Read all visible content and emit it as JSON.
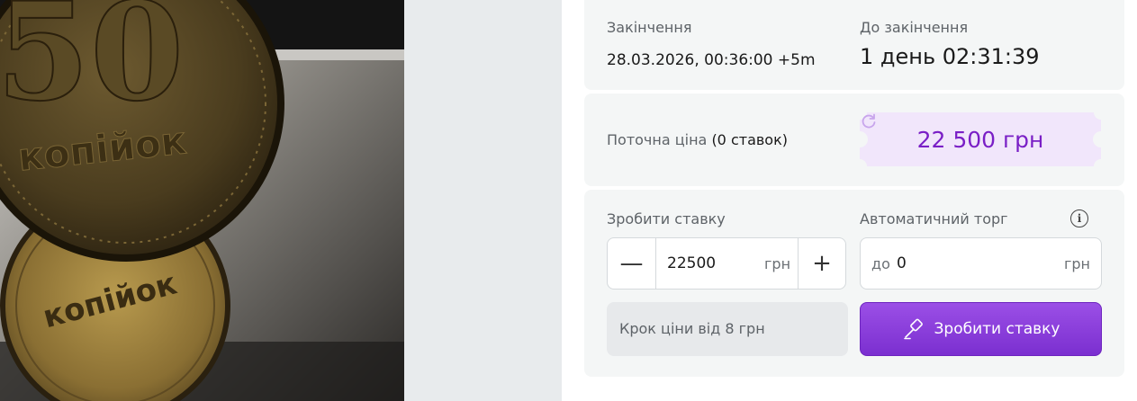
{
  "ending": {
    "label": "Закінчення",
    "datetime": "28.03.2026, 00:36:00 +5m"
  },
  "countdown": {
    "label": "До закінчення",
    "value": "1 день 02:31:39"
  },
  "price": {
    "label": "Поточна ціна",
    "bids": "(0 ставок)",
    "value": "22 500 грн"
  },
  "bid": {
    "label": "Зробити ставку",
    "amount": "22500",
    "unit": "грн",
    "minus": "—",
    "plus": "+"
  },
  "auto": {
    "label": "Автоматичний торг",
    "prefix": "до",
    "amount": "0",
    "unit": "грн",
    "info": "i"
  },
  "step": {
    "text": "Крок ціни від 8 грн"
  },
  "submit": {
    "label": "Зробити ставку"
  },
  "coin": {
    "denomination": "50",
    "word": "копійок"
  },
  "colors": {
    "accent": "#7b2fd0",
    "price_text": "#7a1fc6",
    "price_bg": "#f1e6fb",
    "card_bg": "#f4f6f6"
  }
}
